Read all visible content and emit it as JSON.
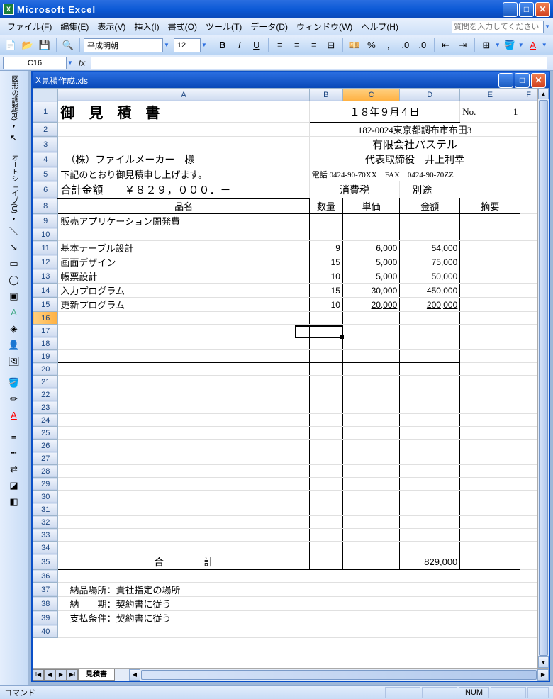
{
  "app": {
    "title": "Microsoft Excel"
  },
  "menubar": {
    "file": "ファイル(F)",
    "edit": "編集(E)",
    "view": "表示(V)",
    "insert": "挿入(I)",
    "format": "書式(O)",
    "tools": "ツール(T)",
    "data": "データ(D)",
    "window": "ウィンドウ(W)",
    "help": "ヘルプ(H)",
    "help_placeholder": "質問を入力してください"
  },
  "toolbar": {
    "font_name": "平成明朝",
    "font_size": "12"
  },
  "namebox": {
    "cell_ref": "C16"
  },
  "doc": {
    "title": "見積作成.xls"
  },
  "sheet_tab": "見積書",
  "status": {
    "left": "コマンド",
    "num": "NUM"
  },
  "sheet": {
    "title": "御　見　積　書",
    "date": "１８年９月４日",
    "no_label": "No.",
    "no_value": "1",
    "address": "182-0024東京都調布市布田3",
    "company": "有限会社パステル",
    "client": "（株）ファイルメーカー　様",
    "rep": "代表取締役　井上利幸",
    "intro": "下記のとおり御見積申し上げます。",
    "tel_label": "電話",
    "tel": "0424-90-70XX",
    "fax_label": "FAX",
    "fax": "0424-90-70ZZ",
    "total_label": "合計金額",
    "total_amount": "￥８２９，０００．－",
    "tax_label": "消費税",
    "tax_value": "別途",
    "hdr_item": "品名",
    "hdr_qty": "数量",
    "hdr_price": "単価",
    "hdr_amount": "金額",
    "hdr_note": "摘要",
    "cat1": "販売アプリケーション開発費",
    "items": [
      {
        "name": "基本テーブル設計",
        "qty": "9",
        "price": "6,000",
        "amount": "54,000"
      },
      {
        "name": "画面デザイン",
        "qty": "15",
        "price": "5,000",
        "amount": "75,000"
      },
      {
        "name": "帳票設計",
        "qty": "10",
        "price": "5,000",
        "amount": "50,000"
      },
      {
        "name": "入力プログラム",
        "qty": "15",
        "price": "30,000",
        "amount": "450,000"
      },
      {
        "name": "更新プログラム",
        "qty": "10",
        "price": "20,000",
        "amount": "200,000"
      }
    ],
    "sum_label": "合　　　　計",
    "sum_amount": "829,000",
    "footer1": "納品場所：貴社指定の場所",
    "footer2": "納　　期：契約書に従う",
    "footer3": "支払条件：契約書に従う"
  }
}
